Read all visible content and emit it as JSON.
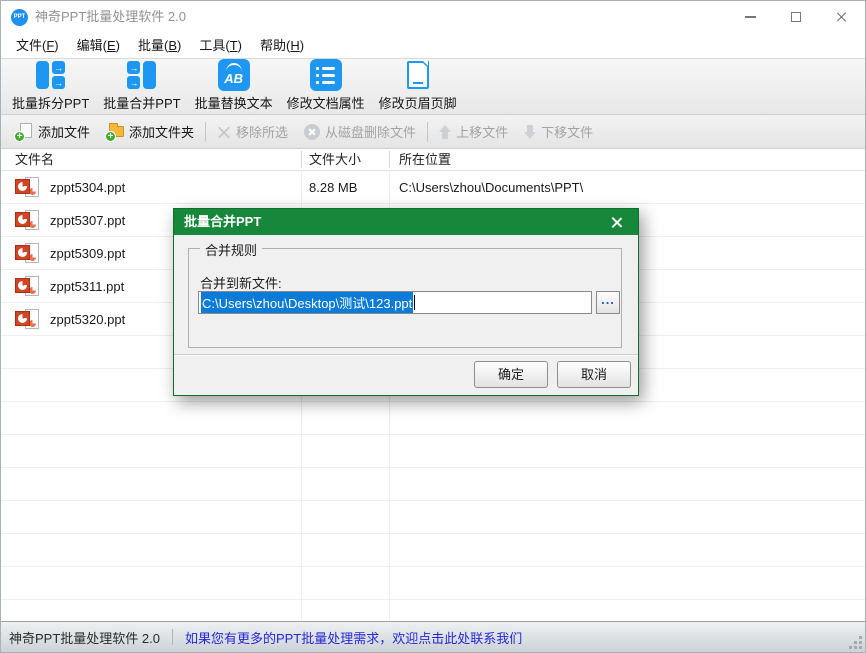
{
  "window": {
    "title": "神奇PPT批量处理软件 2.0"
  },
  "menu": {
    "items": [
      {
        "pre": "文件(",
        "accel": "F",
        "post": ")"
      },
      {
        "pre": "编辑(",
        "accel": "E",
        "post": ")"
      },
      {
        "pre": "批量(",
        "accel": "B",
        "post": ")"
      },
      {
        "pre": "工具(",
        "accel": "T",
        "post": ")"
      },
      {
        "pre": "帮助(",
        "accel": "H",
        "post": ")"
      }
    ]
  },
  "icons": {
    "arrow_right": "→",
    "plus": "+",
    "replace_letters": "AB",
    "app_badge": "PPT"
  },
  "toolbar_main": {
    "items": [
      {
        "label": "批量拆分PPT"
      },
      {
        "label": "批量合并PPT"
      },
      {
        "label": "批量替换文本"
      },
      {
        "label": "修改文档属性"
      },
      {
        "label": "修改页眉页脚"
      }
    ]
  },
  "toolbar_files": {
    "items": [
      {
        "label": "添加文件",
        "enabled": true
      },
      {
        "label": "添加文件夹",
        "enabled": true
      },
      {
        "label": "移除所选",
        "enabled": false
      },
      {
        "label": "从磁盘删除文件",
        "enabled": false
      },
      {
        "label": "上移文件",
        "enabled": false
      },
      {
        "label": "下移文件",
        "enabled": false
      }
    ]
  },
  "table": {
    "columns": [
      "文件名",
      "文件大小",
      "所在位置"
    ],
    "rows": [
      {
        "name": "zppt5304.ppt",
        "size": "8.28 MB",
        "location": "C:\\Users\\zhou\\Documents\\PPT\\"
      },
      {
        "name": "zppt5307.ppt",
        "size": "",
        "location": ""
      },
      {
        "name": "zppt5309.ppt",
        "size": "",
        "location": ""
      },
      {
        "name": "zppt5311.ppt",
        "size": "",
        "location": ""
      },
      {
        "name": "zppt5320.ppt",
        "size": "",
        "location": ""
      }
    ]
  },
  "dialog": {
    "title": "批量合并PPT",
    "group_label": "合并规则",
    "field_label": "合并到新文件:",
    "path_value": "C:\\Users\\zhou\\Desktop\\测试\\123.ppt",
    "browse_label": "...",
    "ok_label": "确定",
    "cancel_label": "取消"
  },
  "statusbar": {
    "app_name": "神奇PPT批量处理软件 2.0",
    "link_text": "如果您有更多的PPT批量处理需求，欢迎点击此处联系我们"
  },
  "colors": {
    "accent_blue": "#1E97F3",
    "dialog_green": "#17873B",
    "selection_blue": "#0A7BD8",
    "link_blue": "#2727D8",
    "ppt_orange": "#D14524"
  }
}
